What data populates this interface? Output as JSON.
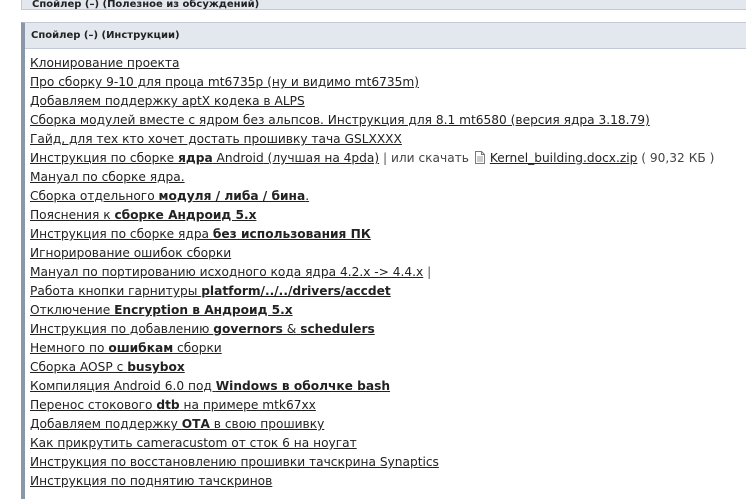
{
  "prev_spoiler": {
    "title": "Спойлер (–) (Полезное из обсуждений)"
  },
  "spoiler": {
    "title": "Спойлер (–) (Инструкции)"
  },
  "items": [
    {
      "text": "Клонирование проекта"
    },
    {
      "text": "Про сборку 9-10 для проца mt6735p (ну и видимо mt6735m)"
    },
    {
      "text": "Добавляем поддержку aptX кодека в ALPS"
    },
    {
      "text": "Сборка модулей вместе с ядром без альпсов. Инструкция для 8.1 mt6580 (версия ядра 3.18.79)"
    },
    {
      "text": "Гайд, для тех кто хочет достать прошивку тача GSLXXXX"
    },
    {
      "a": "Инструкция по сборке ",
      "b": "ядра",
      "c": " Android",
      "d": " (лучшая на 4pda)"
    },
    {
      "text": "Мануал по сборке ядра."
    },
    {
      "a": "Сборка отдельного ",
      "b": "модуля / либа / бина",
      "c": "."
    },
    {
      "a": "Пояснения к ",
      "b": "сборке Андроид 5.х",
      "c": ""
    },
    {
      "a": "Инструкция по сборке ядра ",
      "b": "без использования ПК",
      "c": ""
    },
    {
      "text": "Игнорирование ошибок сборки"
    },
    {
      "text": "Мануал по портированию исходного кода ядра 4.2.x -> 4.4.x"
    },
    {
      "a": "Работа кнопки гарнитуры ",
      "b": "platform/../../drivers/accdet",
      "c": ""
    },
    {
      "a": "Отключение ",
      "b": "Encryption в Андроид 5.х",
      "c": ""
    },
    {
      "a": "Инструкция по добавлению ",
      "b": "governors",
      "c": " & ",
      "d": "schedulers"
    },
    {
      "a": "Немного по ",
      "b": "ошибкам",
      "c": " сборки"
    },
    {
      "a": "Сборка AOSP с ",
      "b": "busybox",
      "c": ""
    },
    {
      "a": "Компиляция Android 6.0 под ",
      "b": "Windows в оболчке bash",
      "c": ""
    },
    {
      "a": "Перенос стокового ",
      "b": "dtb",
      "c": " на примере mtk67xx"
    },
    {
      "a": "Добавляем поддержку ",
      "b": "ОТА",
      "c": " в свою прошивку"
    },
    {
      "text": "Как прикрутить cameracustom от сток 6 на ноугат"
    },
    {
      "text": "Инструкция по восстановлению прошивки тачскрина Synaptics"
    },
    {
      "text": "Инструкция по поднятию тачскринов"
    }
  ],
  "inline": {
    "separator": " | ",
    "or_download": "или скачать",
    "file_name": "Kernel_building.docx.zip",
    "file_size": " ( 90,32 КБ )"
  },
  "icons": {
    "file": "file-icon"
  }
}
